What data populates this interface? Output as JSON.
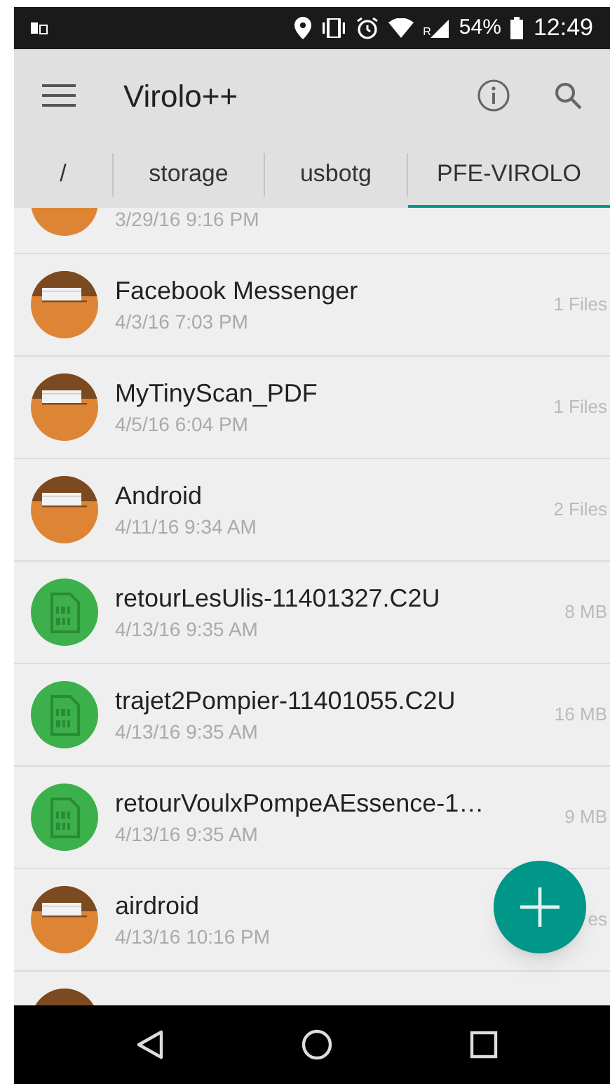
{
  "status_bar": {
    "roaming_mark": "R",
    "battery": "54%",
    "time": "12:49"
  },
  "app_bar": {
    "title": "Virolo++"
  },
  "breadcrumbs": [
    {
      "label": "/",
      "selected": false
    },
    {
      "label": "storage",
      "selected": false
    },
    {
      "label": "usbotg",
      "selected": false
    },
    {
      "label": "PFE-VIROLO",
      "selected": true
    }
  ],
  "files": [
    {
      "kind": "folder",
      "date": "3/29/16 9:16 PM"
    },
    {
      "kind": "folder",
      "name": "Facebook Messenger",
      "date": "4/3/16 7:03 PM",
      "size": "1 Files"
    },
    {
      "kind": "folder",
      "name": "MyTinyScan_PDF",
      "date": "4/5/16 6:04 PM",
      "size": "1 Files"
    },
    {
      "kind": "folder",
      "name": "Android",
      "date": "4/11/16 9:34 AM",
      "size": "2 Files"
    },
    {
      "kind": "binary",
      "name": "retourLesUlis-11401327.C2U",
      "date": "4/13/16 9:35 AM",
      "size": "8 MB"
    },
    {
      "kind": "binary",
      "name": "trajet2Pompier-11401055.C2U",
      "date": "4/13/16 9:35 AM",
      "size": "16 MB"
    },
    {
      "kind": "binary",
      "name": "retourVoulxPompeAEssence-1…",
      "date": "4/13/16 9:35 AM",
      "size": "9 MB"
    },
    {
      "kind": "folder",
      "name": "airdroid",
      "date": "4/13/16 10:16 PM",
      "size": "es"
    },
    {
      "kind": "folder"
    }
  ]
}
